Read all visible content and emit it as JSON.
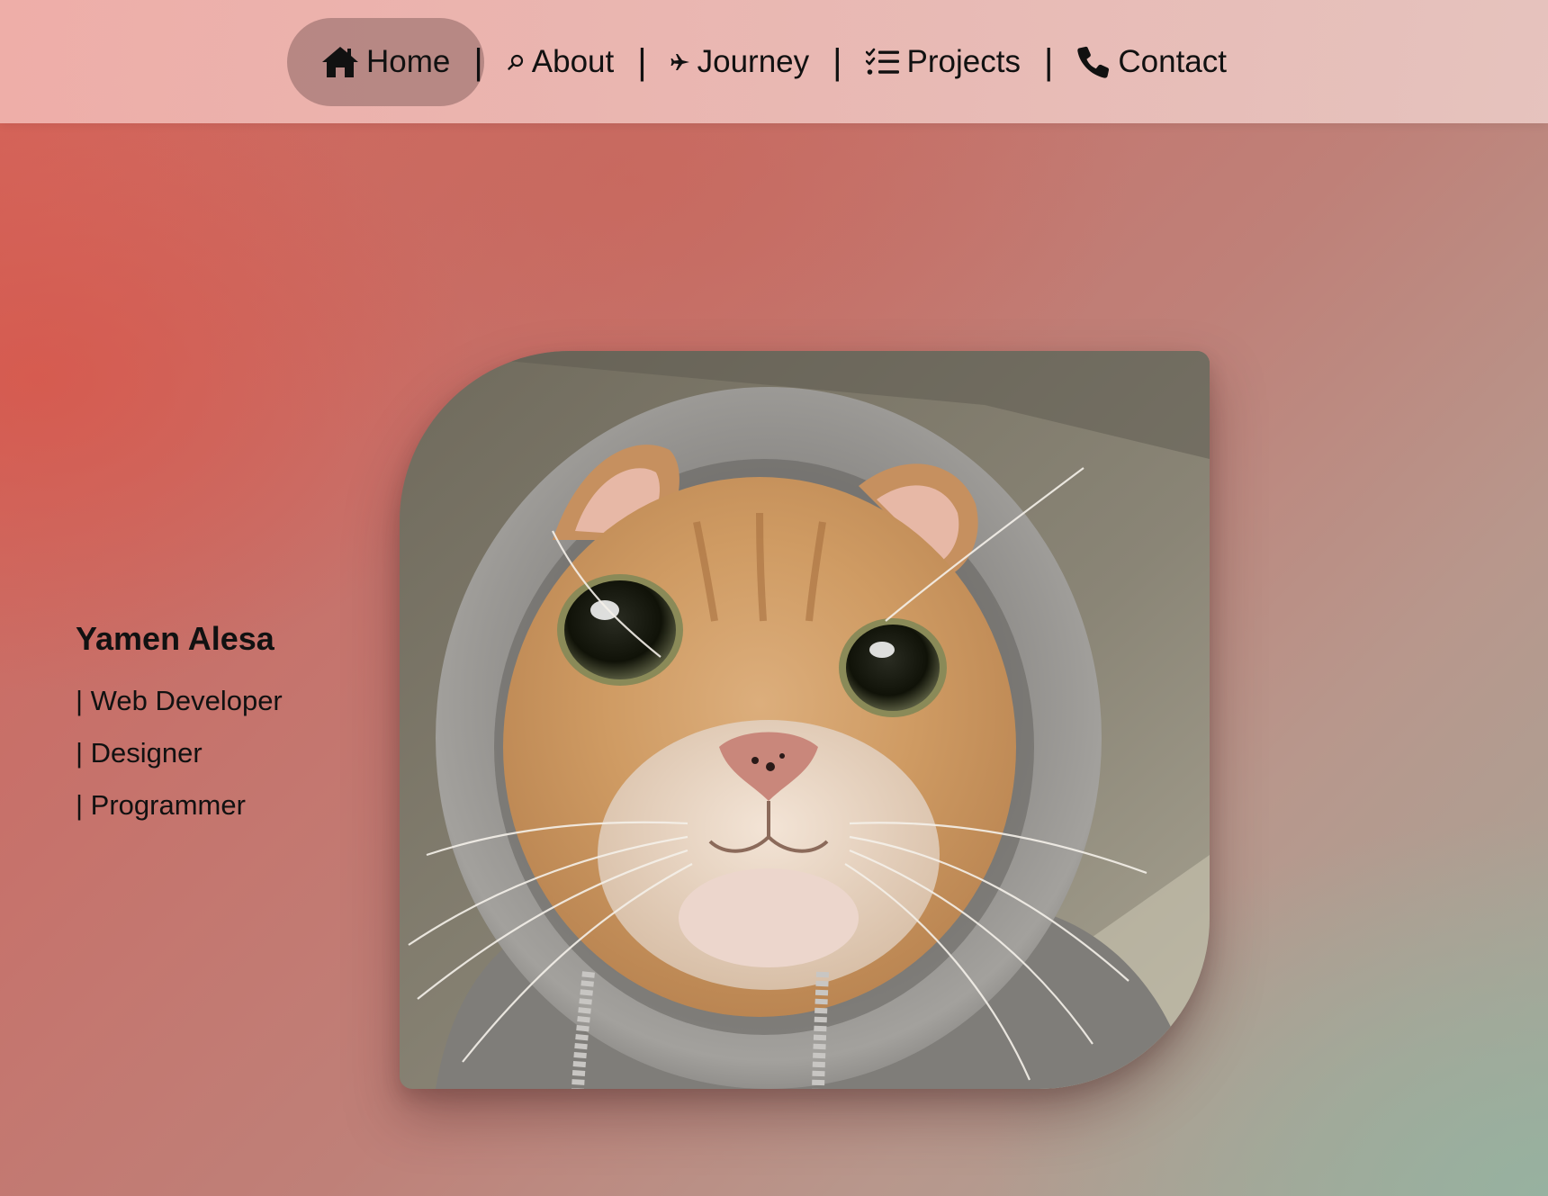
{
  "nav": {
    "items": [
      {
        "label": "Home",
        "icon": "home-icon",
        "active": true
      },
      {
        "label": "About",
        "icon": "search-icon",
        "active": false
      },
      {
        "label": "Journey",
        "icon": "airplane-icon",
        "active": false
      },
      {
        "label": "Projects",
        "icon": "checklist-icon",
        "active": false
      },
      {
        "label": "Contact",
        "icon": "phone-icon",
        "active": false
      }
    ],
    "separator": "|"
  },
  "hero": {
    "name": "Yamen Alesa",
    "roles": [
      "| Web Developer",
      "| Designer",
      "| Programmer"
    ]
  },
  "photo": {
    "subject": "cat-in-hoodie",
    "alt": "Profile photo of a ginger cat wearing a grey hoodie"
  },
  "colors": {
    "background_start": "#d66358",
    "background_end": "#a5a698",
    "navbar": "#ecc0bb",
    "active_pill": "#a47b77",
    "text": "#111111"
  }
}
